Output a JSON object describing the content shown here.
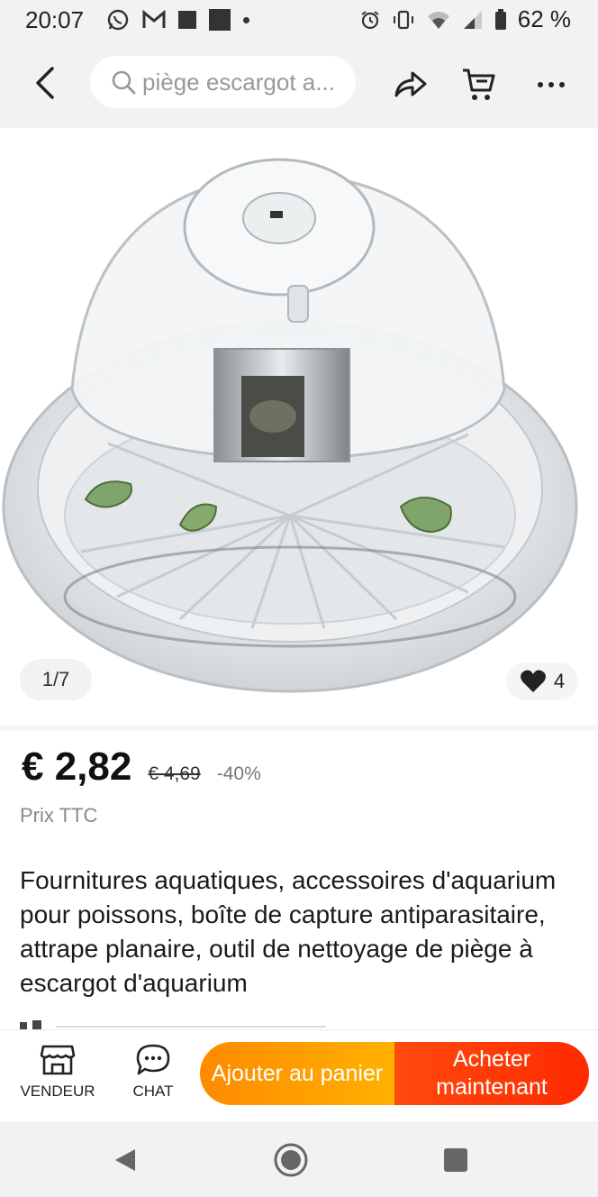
{
  "status_bar": {
    "time": "20:07",
    "battery": "62 %",
    "left_icons": [
      "whatsapp-icon",
      "gmail-icon",
      "square-icon",
      "square-icon",
      "dot-icon"
    ],
    "right_icons": [
      "alarm-icon",
      "vibrate-icon",
      "wifi-icon",
      "signal-icon",
      "battery-icon"
    ]
  },
  "top_bar": {
    "search_text": "piège escargot a...",
    "icons": [
      "back-icon",
      "search-icon",
      "share-icon",
      "cart-icon",
      "more-icon"
    ]
  },
  "gallery": {
    "counter": "1/7",
    "likes": "4"
  },
  "product": {
    "price": "€ 2,82",
    "original_price": "€ 4,69",
    "discount": "-40%",
    "price_note": "Prix TTC",
    "title": "Fournitures aquatiques, accessoires d'aquarium pour poissons, boîte de capture antiparasitaire, attrape planaire, outil de nettoyage de piège à escargot d'aquarium"
  },
  "bottom_bar": {
    "seller_label": "VENDEUR",
    "chat_label": "CHAT",
    "add_to_cart_label": "Ajouter au panier",
    "buy_now_label": "Acheter maintenant"
  },
  "colors": {
    "cart_button": "#ff9a00",
    "buy_button": "#ff3a00",
    "background_bar": "#f2f2f2"
  }
}
